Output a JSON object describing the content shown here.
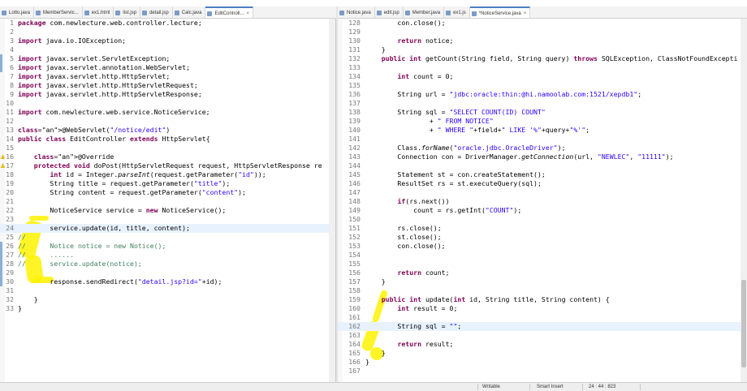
{
  "left_tabs": [
    {
      "label": "Lotto.java",
      "active": false
    },
    {
      "label": "MemberServic...",
      "active": false
    },
    {
      "label": "ex1.html",
      "active": false
    },
    {
      "label": "list.jsp",
      "active": false
    },
    {
      "label": "detail.jsp",
      "active": false
    },
    {
      "label": "Calc.java",
      "active": false
    },
    {
      "label": "EditControll...",
      "active": true
    }
  ],
  "right_tabs": [
    {
      "label": "Notice.java",
      "active": false
    },
    {
      "label": "edit.jsp",
      "active": false
    },
    {
      "label": "Member.java",
      "active": false
    },
    {
      "label": "ex1.js",
      "active": false
    },
    {
      "label": "*NoticeService.java",
      "active": true
    }
  ],
  "left_editor": {
    "file": "EditController.java",
    "lines": [
      {
        "n": "1",
        "t": "package com.newlecture.web.controller.lecture;"
      },
      {
        "n": "2",
        "t": ""
      },
      {
        "n": "3",
        "t": "import java.io.IOException;"
      },
      {
        "n": "4",
        "t": ""
      },
      {
        "n": "5",
        "t": "import javax.servlet.ServletException;"
      },
      {
        "n": "6",
        "t": "import javax.servlet.annotation.WebServlet;"
      },
      {
        "n": "7",
        "t": "import javax.servlet.http.HttpServlet;"
      },
      {
        "n": "8",
        "t": "import javax.servlet.http.HttpServletRequest;"
      },
      {
        "n": "9",
        "t": "import javax.servlet.http.HttpServletResponse;"
      },
      {
        "n": "10",
        "t": ""
      },
      {
        "n": "11",
        "t": "import com.newlecture.web.service.NoticeService;"
      },
      {
        "n": "12",
        "t": ""
      },
      {
        "n": "13",
        "t": "@WebServlet(\"/notice/edit\")"
      },
      {
        "n": "14",
        "t": "public class EditController extends HttpServlet{"
      },
      {
        "n": "15",
        "t": ""
      },
      {
        "n": "16",
        "t": "    @Override"
      },
      {
        "n": "17",
        "t": "    protected void doPost(HttpServletRequest request, HttpServletResponse re"
      },
      {
        "n": "18",
        "t": "        int id = Integer.parseInt(request.getParameter(\"id\"));"
      },
      {
        "n": "19",
        "t": "        String title = request.getParameter(\"title\");"
      },
      {
        "n": "20",
        "t": "        String content = request.getParameter(\"content\");"
      },
      {
        "n": "21",
        "t": ""
      },
      {
        "n": "22",
        "t": "        NoticeService service = new NoticeService();"
      },
      {
        "n": "23",
        "t": ""
      },
      {
        "n": "24",
        "t": "        service.update(id, title, content);"
      },
      {
        "n": "25",
        "t": "//"
      },
      {
        "n": "26",
        "t": "//      Notice notice = new Notice();"
      },
      {
        "n": "27",
        "t": "//      ......"
      },
      {
        "n": "28",
        "t": "//      service.update(notice);"
      },
      {
        "n": "29",
        "t": ""
      },
      {
        "n": "30",
        "t": "        response.sendRedirect(\"detail.jsp?id=\"+id);"
      },
      {
        "n": "31",
        "t": ""
      },
      {
        "n": "32",
        "t": "    }"
      },
      {
        "n": "33",
        "t": "}"
      }
    ]
  },
  "right_editor": {
    "file": "NoticeService.java",
    "lines": [
      {
        "n": "128",
        "t": "        con.close();"
      },
      {
        "n": "129",
        "t": ""
      },
      {
        "n": "130",
        "t": "        return notice;"
      },
      {
        "n": "131",
        "t": "    }"
      },
      {
        "n": "132",
        "t": "    public int getCount(String field, String query) throws SQLException, ClassNotFoundExcepti"
      },
      {
        "n": "133",
        "t": ""
      },
      {
        "n": "134",
        "t": "        int count = 0;"
      },
      {
        "n": "135",
        "t": ""
      },
      {
        "n": "136",
        "t": "        String url = \"jdbc:oracle:thin:@hi.namoolab.com:1521/xepdb1\";"
      },
      {
        "n": "137",
        "t": ""
      },
      {
        "n": "138",
        "t": "        String sql = \"SELECT COUNT(ID) COUNT\""
      },
      {
        "n": "139",
        "t": "                + \" FROM NOTICE\""
      },
      {
        "n": "140",
        "t": "                + \" WHERE \"+field+\" LIKE '%\"+query+\"%'\";"
      },
      {
        "n": "141",
        "t": ""
      },
      {
        "n": "142",
        "t": "        Class.forName(\"oracle.jdbc.OracleDriver\");"
      },
      {
        "n": "143",
        "t": "        Connection con = DriverManager.getConnection(url, \"NEWLEC\", \"11111\");"
      },
      {
        "n": "144",
        "t": ""
      },
      {
        "n": "145",
        "t": "        Statement st = con.createStatement();"
      },
      {
        "n": "146",
        "t": "        ResultSet rs = st.executeQuery(sql);"
      },
      {
        "n": "147",
        "t": ""
      },
      {
        "n": "148",
        "t": "        if(rs.next())"
      },
      {
        "n": "149",
        "t": "            count = rs.getInt(\"COUNT\");"
      },
      {
        "n": "150",
        "t": ""
      },
      {
        "n": "151",
        "t": "        rs.close();"
      },
      {
        "n": "152",
        "t": "        st.close();"
      },
      {
        "n": "153",
        "t": "        con.close();"
      },
      {
        "n": "154",
        "t": ""
      },
      {
        "n": "155",
        "t": ""
      },
      {
        "n": "156",
        "t": "        return count;"
      },
      {
        "n": "157",
        "t": "    }"
      },
      {
        "n": "158",
        "t": ""
      },
      {
        "n": "159",
        "t": "    public int update(int id, String title, String content) {"
      },
      {
        "n": "160",
        "t": "        int result = 0;"
      },
      {
        "n": "161",
        "t": ""
      },
      {
        "n": "162",
        "t": "        String sql = \"\";"
      },
      {
        "n": "163",
        "t": ""
      },
      {
        "n": "164",
        "t": "        return result;"
      },
      {
        "n": "165",
        "t": "    }"
      },
      {
        "n": "166",
        "t": "}"
      },
      {
        "n": "167",
        "t": ""
      }
    ]
  },
  "status_bar": {
    "mode": "Writable",
    "insert": "Smart Insert",
    "position": "24 : 44 : 823"
  },
  "colors": {
    "keyword": "#7f0055",
    "string": "#2a00ff",
    "annotation": "#646464",
    "highlighter": "#fff200",
    "current_line": "#e8f2fe"
  }
}
